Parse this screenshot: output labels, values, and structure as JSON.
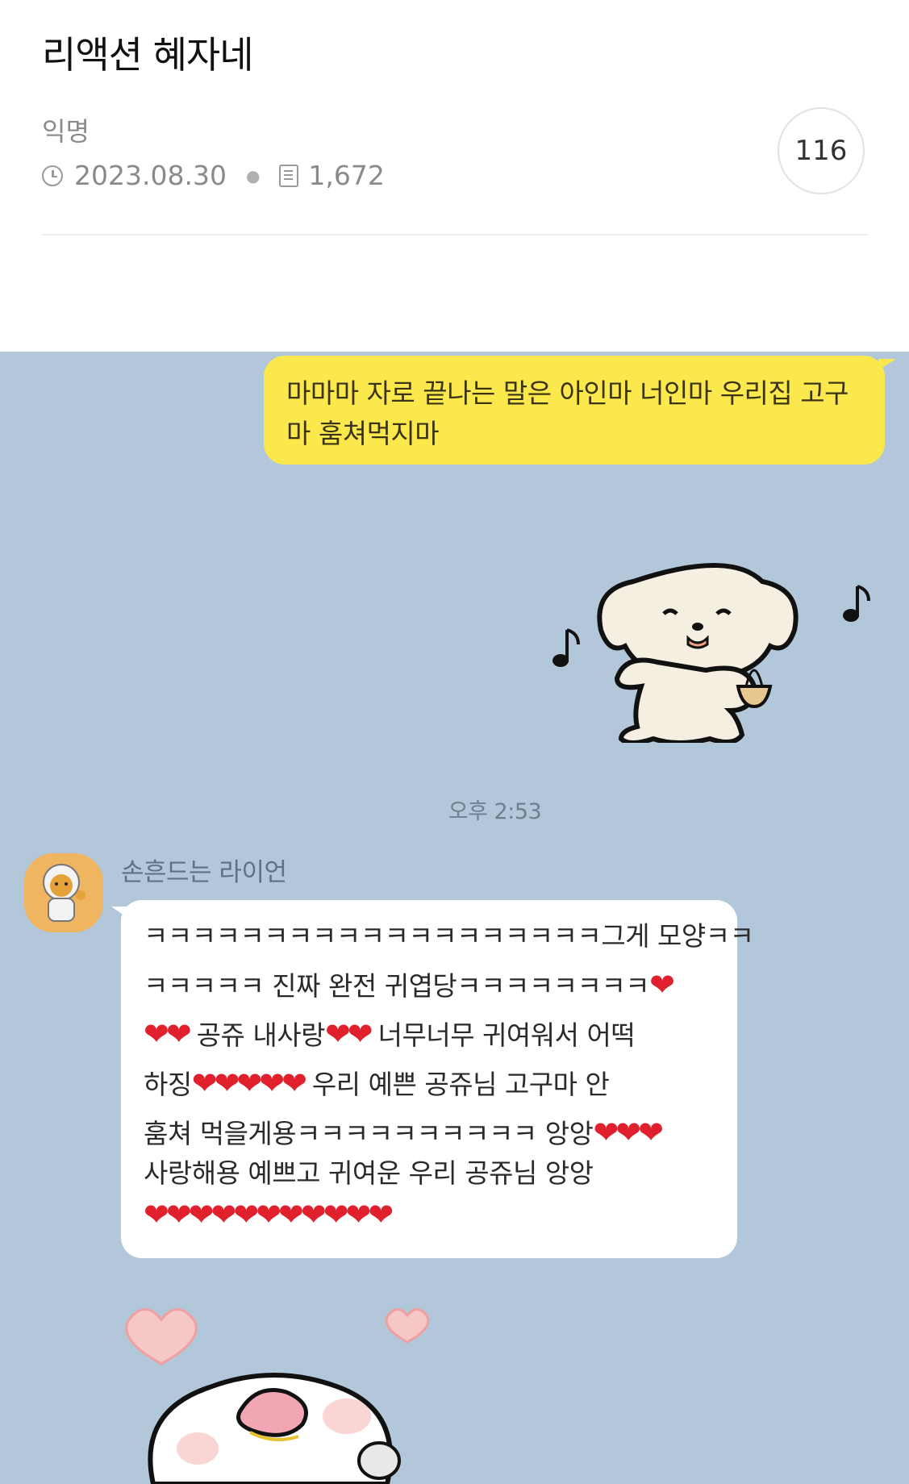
{
  "post": {
    "title": "리액션 혜자네",
    "author": "익명",
    "date": "2023.08.30",
    "views": "1,672",
    "comment_count": "116"
  },
  "chat": {
    "outgoing_message": "마마마 자로 끝나는 말은 아인마 너인마 우리집 고구마 훔쳐먹지마",
    "outgoing_lines": [
      "마마마 자로 끝나는 말은 아인마 너인마 우리집 고구",
      "마 훔쳐먹지마"
    ],
    "timestamp": "오후 2:53",
    "sender_name": "손흔드는 라이언",
    "incoming_lines": [
      {
        "text": "ㅋㅋㅋㅋㅋㅋㅋㅋㅋㅋㅋㅋㅋㅋㅋㅋㅋㅋㅋ그게 모양ㅋㅋ",
        "hearts": ""
      },
      {
        "text": "ㅋㅋㅋㅋㅋ 진짜 완전 귀엽당ㅋㅋㅋㅋㅋㅋㅋㅋ",
        "hearts": "❤"
      },
      {
        "text": "",
        "hearts": "❤❤",
        "text2": " 공쥬 내사랑",
        "hearts2": "❤❤",
        "text3": " 너무너무 귀여워서 어떡"
      },
      {
        "text": "하징",
        "hearts": "❤❤❤❤❤",
        "text2": " 우리 예쁜 공쥬님 고구마 안"
      },
      {
        "text": "훔쳐 먹을게용ㅋㅋㅋㅋㅋㅋㅋㅋㅋㅋ 앙앙",
        "hearts": "❤❤❤"
      },
      {
        "text": "사랑해용 예쁘고 귀여운 우리 공쥬님 앙앙",
        "hearts": ""
      },
      {
        "text": "",
        "hearts": "❤❤❤❤❤❤❤❤❤❤❤"
      }
    ],
    "stickers": [
      "dancing-puppy-sticker",
      "blushing-chick-sticker"
    ],
    "colors": {
      "background": "#b2c7d9",
      "outgoing_bubble": "#fbe84c",
      "incoming_bubble": "#ffffff",
      "heart": "#e0202d"
    }
  }
}
